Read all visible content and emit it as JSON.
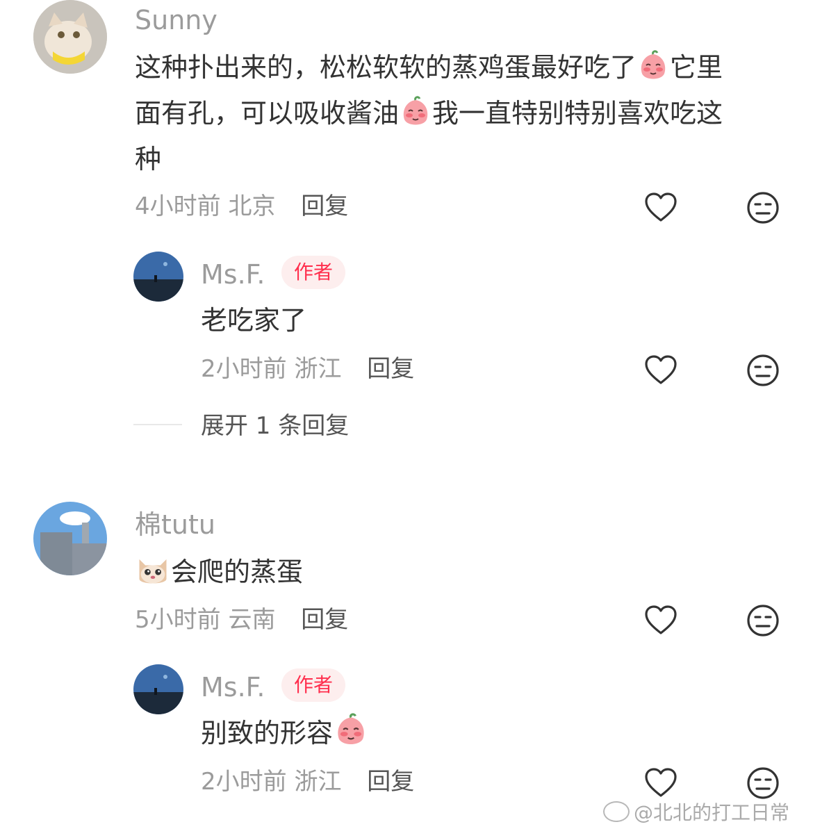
{
  "comments": [
    {
      "username": "Sunny",
      "avatar_icon": "cat-avatar",
      "text_parts": [
        "这种扑出来的，松松软软的蒸鸡蛋最好吃了",
        "它里",
        "面有孔，可以吸收酱油",
        "我一直特别特别喜欢吃这",
        "种"
      ],
      "emoji_icon": "peach-blush-emoji",
      "time": "4小时前",
      "location": "北京",
      "reply_label": "回复",
      "replies": [
        {
          "username": "Ms.F.",
          "badge": "作者",
          "avatar_icon": "night-sky-avatar",
          "text": "老吃家了",
          "time": "2小时前",
          "location": "浙江",
          "reply_label": "回复"
        }
      ],
      "expand_label": "展开 1 条回复"
    },
    {
      "username": "棉tutu",
      "avatar_icon": "building-sky-avatar",
      "emoji_icon": "cat-face-emoji",
      "text": "会爬的蒸蛋",
      "time": "5小时前",
      "location": "云南",
      "reply_label": "回复",
      "replies": [
        {
          "username": "Ms.F.",
          "badge": "作者",
          "avatar_icon": "night-sky-avatar",
          "text": "别致的形容",
          "emoji_icon": "peach-shy-emoji",
          "time": "2小时前",
          "location": "浙江",
          "reply_label": "回复"
        }
      ]
    }
  ],
  "watermark": "@北北的打工日常",
  "colors": {
    "username": "#9b9b9b",
    "text": "#333333",
    "badge_bg": "#fdeeee",
    "badge_text": "#ff2e4d"
  }
}
